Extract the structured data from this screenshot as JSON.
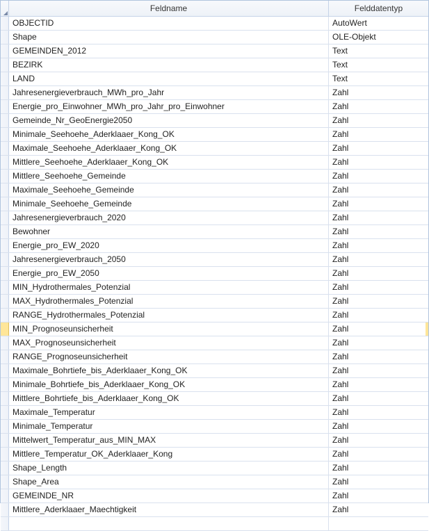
{
  "headers": {
    "fieldname": "Feldname",
    "datatype": "Felddatentyp"
  },
  "selected_row": 22,
  "rows": [
    {
      "name": "OBJECTID",
      "type": "AutoWert"
    },
    {
      "name": "Shape",
      "type": "OLE-Objekt"
    },
    {
      "name": "GEMEINDEN_2012",
      "type": "Text"
    },
    {
      "name": "BEZIRK",
      "type": "Text"
    },
    {
      "name": "LAND",
      "type": "Text"
    },
    {
      "name": "Jahresenergieverbrauch_MWh_pro_Jahr",
      "type": "Zahl"
    },
    {
      "name": "Energie_pro_Einwohner_MWh_pro_Jahr_pro_Einwohner",
      "type": "Zahl"
    },
    {
      "name": "Gemeinde_Nr_GeoEnergie2050",
      "type": "Zahl"
    },
    {
      "name": "Minimale_Seehoehe_Aderklaaer_Kong_OK",
      "type": "Zahl"
    },
    {
      "name": "Maximale_Seehoehe_Aderklaaer_Kong_OK",
      "type": "Zahl"
    },
    {
      "name": "Mittlere_Seehoehe_Aderklaaer_Kong_OK",
      "type": "Zahl"
    },
    {
      "name": "Mittlere_Seehoehe_Gemeinde",
      "type": "Zahl"
    },
    {
      "name": "Maximale_Seehoehe_Gemeinde",
      "type": "Zahl"
    },
    {
      "name": "Minimale_Seehoehe_Gemeinde",
      "type": "Zahl"
    },
    {
      "name": "Jahresenergieverbrauch_2020",
      "type": "Zahl"
    },
    {
      "name": "Bewohner",
      "type": "Zahl"
    },
    {
      "name": "Energie_pro_EW_2020",
      "type": "Zahl"
    },
    {
      "name": "Jahresenergieverbrauch_2050",
      "type": "Zahl"
    },
    {
      "name": "Energie_pro_EW_2050",
      "type": "Zahl"
    },
    {
      "name": "MIN_Hydrothermales_Potenzial",
      "type": "Zahl"
    },
    {
      "name": "MAX_Hydrothermales_Potenzial",
      "type": "Zahl"
    },
    {
      "name": "RANGE_Hydrothermales_Potenzial",
      "type": "Zahl"
    },
    {
      "name": "MIN_Prognoseunsicherheit",
      "type": "Zahl"
    },
    {
      "name": "MAX_Prognoseunsicherheit",
      "type": "Zahl"
    },
    {
      "name": "RANGE_Prognoseunsicherheit",
      "type": "Zahl"
    },
    {
      "name": "Maximale_Bohrtiefe_bis_Aderklaaer_Kong_OK",
      "type": "Zahl"
    },
    {
      "name": "Minimale_Bohrtiefe_bis_Aderklaaer_Kong_OK",
      "type": "Zahl"
    },
    {
      "name": "Mittlere_Bohrtiefe_bis_Aderklaaer_Kong_OK",
      "type": "Zahl"
    },
    {
      "name": "Maximale_Temperatur",
      "type": "Zahl"
    },
    {
      "name": "Minimale_Temperatur",
      "type": "Zahl"
    },
    {
      "name": "Mittelwert_Temperatur_aus_MIN_MAX",
      "type": "Zahl"
    },
    {
      "name": "Mittlere_Temperatur_OK_Aderklaaer_Kong",
      "type": "Zahl"
    },
    {
      "name": "Shape_Length",
      "type": "Zahl"
    },
    {
      "name": "Shape_Area",
      "type": "Zahl"
    },
    {
      "name": "GEMEINDE_NR",
      "type": "Zahl"
    },
    {
      "name": "Mittlere_Aderklaaer_Maechtigkeit",
      "type": "Zahl"
    }
  ]
}
